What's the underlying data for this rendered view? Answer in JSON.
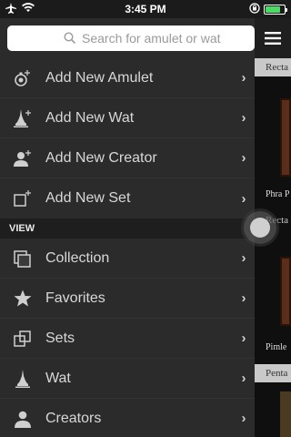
{
  "status": {
    "time": "3:45 PM",
    "battery_level": 0.8
  },
  "search": {
    "placeholder": "Search for amulet or wat"
  },
  "menu": {
    "add_items": [
      {
        "label": "Add New Amulet",
        "icon": "amulet-add-icon"
      },
      {
        "label": "Add New Wat",
        "icon": "wat-add-icon"
      },
      {
        "label": "Add New Creator",
        "icon": "creator-add-icon"
      },
      {
        "label": "Add New Set",
        "icon": "set-add-icon"
      }
    ],
    "view_section": "VIEW",
    "view_items": [
      {
        "label": "Collection",
        "icon": "collection-icon"
      },
      {
        "label": "Favorites",
        "icon": "star-icon"
      },
      {
        "label": "Sets",
        "icon": "sets-icon"
      },
      {
        "label": "Wat",
        "icon": "wat-icon"
      },
      {
        "label": "Creators",
        "icon": "creator-icon"
      }
    ]
  },
  "content": {
    "sections": [
      "Recta",
      "Recta",
      "Penta"
    ],
    "captions": [
      "Phra P",
      "Pimle"
    ]
  }
}
